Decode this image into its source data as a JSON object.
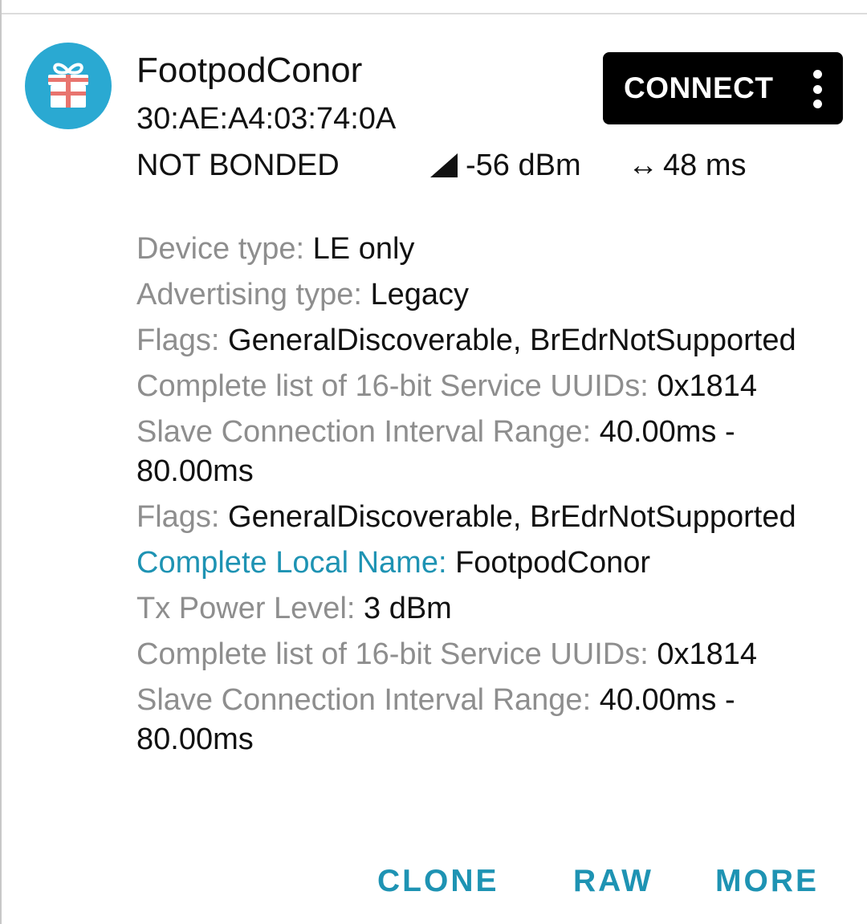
{
  "device": {
    "name": "FootpodConor",
    "address": "30:AE:A4:03:74:0A",
    "bond_state": "NOT BONDED",
    "rssi": "-56 dBm",
    "interval": "48 ms",
    "icon": "gift-icon"
  },
  "buttons": {
    "connect": "CONNECT",
    "overflow_icon": "more-vert-icon"
  },
  "details": [
    {
      "key": "Device type:",
      "value": "LE only"
    },
    {
      "key": "Advertising type:",
      "value": "Legacy"
    },
    {
      "key": "Flags:",
      "value": "GeneralDiscoverable, BrEdrNotSupported"
    },
    {
      "key": "Complete list of 16-bit Service UUIDs:",
      "value": "0x1814"
    },
    {
      "key": "Slave Connection Interval Range:",
      "value": "40.00ms - 80.00ms"
    },
    {
      "key": "Flags:",
      "value": "GeneralDiscoverable, BrEdrNotSupported"
    },
    {
      "key": "Complete Local Name:",
      "value": "FootpodConor"
    },
    {
      "key": "Tx Power Level:",
      "value": "3 dBm"
    },
    {
      "key": "Complete list of 16-bit Service UUIDs:",
      "value": "0x1814"
    },
    {
      "key": "Slave Connection Interval Range:",
      "value": "40.00ms - 80.00ms"
    }
  ],
  "actions": {
    "clone": "CLONE",
    "raw": "RAW",
    "more": "MORE"
  },
  "colors": {
    "accent": "#1e93b3",
    "avatar_bg": "#2aa9d2",
    "label_gray": "#8e8e8e",
    "button_bg": "#000000"
  }
}
